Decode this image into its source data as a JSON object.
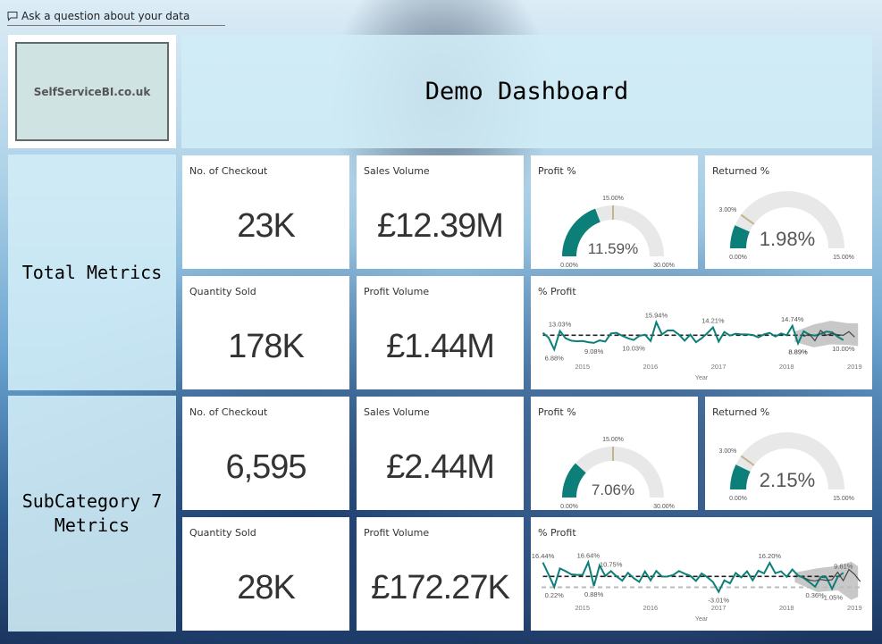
{
  "qa_bar": {
    "icon": "speech-bubble-icon",
    "placeholder": "Ask a question about your data"
  },
  "logo": {
    "text": "SelfServiceBI.co.uk"
  },
  "header": {
    "title": "Demo Dashboard"
  },
  "colors": {
    "teal": "#0c7f79",
    "gauge_bg": "#e8e8e8",
    "target": "#c2b48c",
    "forecast": "#c8c8c8"
  },
  "sections": [
    {
      "label": "Total Metrics",
      "cards": {
        "checkout": {
          "label": "No. of Checkout",
          "value": "23K"
        },
        "sales": {
          "label": "Sales Volume",
          "value": "£12.39M"
        },
        "quantity": {
          "label": "Quantity Sold",
          "value": "178K"
        },
        "profit_volume": {
          "label": "Profit Volume",
          "value": "£1.44M"
        }
      },
      "profit_gauge": {
        "label": "Profit %",
        "value": 11.59,
        "value_text": "11.59%",
        "min": 0,
        "max": 30,
        "target": 15,
        "min_text": "0.00%",
        "max_text": "30.00%",
        "target_text": "15.00%"
      },
      "returned_gauge": {
        "label": "Returned %",
        "value": 1.98,
        "value_text": "1.98%",
        "min": 0,
        "max": 15,
        "target": 3,
        "min_text": "0.00%",
        "max_text": "15.00%",
        "target_text": "3.00%"
      }
    },
    {
      "label": "SubCategory 7 Metrics",
      "cards": {
        "checkout": {
          "label": "No. of Checkout",
          "value": "6,595"
        },
        "sales": {
          "label": "Sales Volume",
          "value": "£2.44M"
        },
        "quantity": {
          "label": "Quantity Sold",
          "value": "28K"
        },
        "profit_volume": {
          "label": "Profit Volume",
          "value": "£172.27K"
        }
      },
      "profit_gauge": {
        "label": "Profit %",
        "value": 7.06,
        "value_text": "7.06%",
        "min": 0,
        "max": 30,
        "target": 15,
        "min_text": "0.00%",
        "max_text": "30.00%",
        "target_text": "15.00%"
      },
      "returned_gauge": {
        "label": "Returned %",
        "value": 2.15,
        "value_text": "2.15%",
        "min": 0,
        "max": 15,
        "target": 3,
        "min_text": "0.00%",
        "max_text": "15.00%",
        "target_text": "3.00%"
      }
    }
  ],
  "chart_data": [
    {
      "type": "line",
      "title": "% Profit",
      "xlabel": "Year",
      "x_ticks": [
        "2015",
        "2016",
        "2017",
        "2018",
        "2019"
      ],
      "x_range": [
        2014.4,
        2019.1
      ],
      "ylim": [
        4,
        20
      ],
      "avg_line": 11.6,
      "series": [
        {
          "name": "% Profit",
          "start": 2014.42,
          "step": 0.0833,
          "values": [
            12.4,
            10.8,
            6.88,
            13.03,
            10.6,
            9.8,
            9.6,
            9.7,
            9.3,
            9.08,
            9.9,
            9.5,
            12.2,
            12.4,
            11.4,
            10.6,
            10.03,
            11.4,
            11.8,
            9.7,
            15.94,
            11.9,
            13.2,
            13.2,
            11.8,
            9.8,
            11.8,
            9.3,
            10.6,
            12.3,
            14.21,
            9.5,
            12.7,
            11.5,
            12.1,
            11.9,
            11.9,
            11.7,
            10.9,
            11.9,
            12.4,
            11.2,
            12.2,
            11.6,
            14.74,
            8.89,
            12.9,
            11.8,
            11.5,
            12.1,
            12.8,
            12.6,
            11.1,
            10.0
          ]
        },
        {
          "name": "Forecast",
          "start": 2018.25,
          "step": 0.0833,
          "values": [
            11.2,
            12.0,
            9.8,
            13.2,
            11.6,
            12.2,
            11.8,
            11.6,
            12.8,
            11.0
          ]
        }
      ],
      "forecast_band": [
        [
          2018.12,
          9.4,
          12.8
        ],
        [
          2018.4,
          7.6,
          15.2
        ],
        [
          2018.65,
          8.6,
          16.4
        ],
        [
          2018.9,
          8.4,
          15.6
        ],
        [
          2019.05,
          8.0,
          15.6
        ]
      ],
      "annotations": [
        "13.03%",
        "6.88%",
        "9.08%",
        "15.94%",
        "10.03%",
        "14.21%",
        "8.89%",
        "14.74%",
        "8.89%",
        "10.00%"
      ]
    },
    {
      "type": "line",
      "title": "% Profit",
      "xlabel": "Year",
      "x_ticks": [
        "2015",
        "2016",
        "2017",
        "2018",
        "2019"
      ],
      "x_range": [
        2014.4,
        2019.1
      ],
      "ylim": [
        -8,
        24
      ],
      "avg_line": 7.2,
      "zero_line": 0,
      "series": [
        {
          "name": "% Profit",
          "start": 2014.42,
          "step": 0.0833,
          "values": [
            16.44,
            8.5,
            0.22,
            12.5,
            10.7,
            8.6,
            8.2,
            8.3,
            16.64,
            0.88,
            14.5,
            7.5,
            10.75,
            7.2,
            4.4,
            9.6,
            6.1,
            3.6,
            10.5,
            4.6,
            10.8,
            7.1,
            7.2,
            8.2,
            10.8,
            9.0,
            7.6,
            4.2,
            9.1,
            6.7,
            3.5,
            -3.01,
            4.6,
            2.6,
            9.5,
            6.6,
            10.6,
            4.6,
            11.0,
            9.2,
            16.2,
            9.3,
            10.6,
            7.0,
            11.8,
            7.8,
            6.2,
            3.4,
            0.36,
            6.8,
            6.6,
            -1.05,
            6.9,
            9.61
          ]
        },
        {
          "name": "Forecast",
          "start": 2018.25,
          "step": 0.0833,
          "values": [
            6.5,
            4.8,
            4.2,
            5.2,
            4.6,
            5.0,
            10.0,
            4.4,
            11.8,
            8.6,
            3.8
          ]
        }
      ],
      "forecast_band": [
        [
          2018.12,
          9.8,
          3.4
        ],
        [
          2018.45,
          12.6,
          -3.2
        ],
        [
          2018.75,
          14.2,
          -2.0
        ],
        [
          2018.95,
          17.0,
          -8.4
        ],
        [
          2019.05,
          14.0,
          -6.4
        ]
      ],
      "annotations": [
        "16.44%",
        "0.22%",
        "16.64%",
        "0.88%",
        "10.75%",
        "-3.01%",
        "16.20%",
        "0.36%",
        "-1.05%",
        "9.61%"
      ]
    }
  ]
}
